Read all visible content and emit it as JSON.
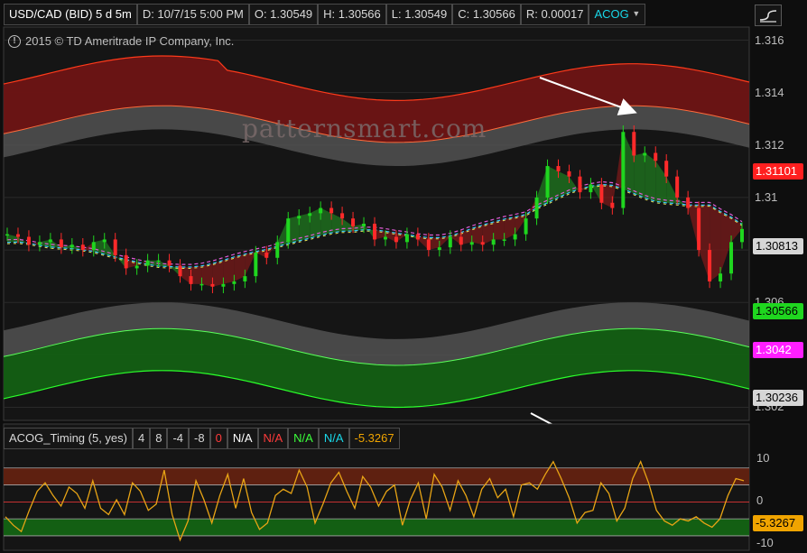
{
  "header": {
    "symbol": "USD/CAD (BID) 5 d 5m",
    "date": "D: 10/7/15 5:00 PM",
    "open": "O: 1.30549",
    "high": "H: 1.30566",
    "low": "L: 1.30549",
    "close": "C: 1.30566",
    "range": "R: 0.00017",
    "study": "ACOG",
    "study_menu_icon": "dropdown-arrow-icon",
    "tool_icon": "curve-tool-icon"
  },
  "copyright": "2015 © TD Ameritrade IP Company, Inc.",
  "watermark": "patternsmart.com",
  "price_axis": {
    "ticks": [
      "1.316",
      "1.314",
      "1.312",
      "1.31",
      "1.308",
      "1.306",
      "1.304",
      "1.302"
    ],
    "badges": [
      {
        "text": "1.31101",
        "bg": "#ff1f1f",
        "fg": "#ffffff",
        "value": 1.31101
      },
      {
        "text": "1.30813",
        "bg": "#d6d6d6",
        "fg": "#000000",
        "value": 1.30813
      },
      {
        "text": "1.30566",
        "bg": "#1fd61f",
        "fg": "#000000",
        "value": 1.30566
      },
      {
        "text": "1.3042",
        "bg": "#ff1fff",
        "fg": "#ffffff",
        "value": 1.3042
      },
      {
        "text": "1.30236",
        "bg": "#d6d6d6",
        "fg": "#000000",
        "value": 1.30236
      }
    ]
  },
  "indicator": {
    "name": "ACOG_Timing (5, yes)",
    "params": [
      "4",
      "8",
      "-4",
      "-8"
    ],
    "value_0": "0",
    "na_white": "N/A",
    "na_red": "N/A",
    "na_green": "N/A",
    "na_cyan": "N/A",
    "current": "-5.3267",
    "axis_ticks": [
      "10",
      "0",
      "-10"
    ],
    "current_badge_bg": "#f0a400"
  },
  "colors": {
    "background": "#0e0e0e",
    "up_candle": "#1fd61f",
    "down_candle": "#ff2a2a",
    "band_red": "#6e1414",
    "band_green": "#135f13",
    "band_gray": "#555555",
    "oscillator": "#e8a415"
  },
  "chart_data": [
    {
      "type": "candlestick",
      "title": "USD/CAD (BID) 5 d 5m",
      "ylim": [
        1.3015,
        1.3165
      ],
      "y_ticks": [
        1.316,
        1.314,
        1.312,
        1.31,
        1.308,
        1.306,
        1.304,
        1.302
      ],
      "grid": true,
      "series": [
        {
          "name": "close",
          "values": [
            1.3086,
            1.3085,
            1.3082,
            1.3083,
            1.3084,
            1.3081,
            1.3082,
            1.308,
            1.3083,
            1.3084,
            1.3078,
            1.3073,
            1.3074,
            1.3076,
            1.3076,
            1.3074,
            1.307,
            1.3067,
            1.3067,
            1.3066,
            1.3067,
            1.3068,
            1.307,
            1.3079,
            1.3077,
            1.3083,
            1.3092,
            1.3093,
            1.3094,
            1.3096,
            1.3094,
            1.3092,
            1.3089,
            1.309,
            1.3084,
            1.3085,
            1.3083,
            1.3086,
            1.3084,
            1.308,
            1.3081,
            1.3085,
            1.3082,
            1.3083,
            1.3082,
            1.3084,
            1.3084,
            1.3086,
            1.3092,
            1.31,
            1.3112,
            1.311,
            1.3108,
            1.3102,
            1.3105,
            1.3098,
            1.3096,
            1.3125,
            1.3116,
            1.3117,
            1.3114,
            1.3108,
            1.31,
            1.3096,
            1.308,
            1.3068,
            1.3071,
            1.3083,
            1.3088
          ]
        }
      ]
    },
    {
      "type": "line",
      "title": "ACOG_Timing (5, yes)",
      "ylim": [
        -11,
        12
      ],
      "y_ticks": [
        10,
        0,
        -10
      ],
      "series": [
        {
          "name": "ACOG_Timing",
          "values": [
            -3.5,
            -5.5,
            -7.0,
            -2.0,
            2.5,
            4.5,
            1.5,
            -1.0,
            3.5,
            2.0,
            -1.5,
            5.0,
            -1.5,
            -3.0,
            0.5,
            -3.0,
            4.5,
            2.5,
            -2.0,
            -0.5,
            7.5,
            -3.0,
            -9.0,
            -4.5,
            5.0,
            0.5,
            -5.0,
            1.5,
            6.5,
            -1.5,
            5.5,
            -2.5,
            -6.5,
            -5.0,
            1.5,
            3.0,
            2.0,
            7.5,
            3.5,
            -5.0,
            -0.5,
            4.5,
            7.0,
            2.5,
            -1.5,
            6.0,
            3.5,
            -1.0,
            2.5,
            4.0,
            -5.5,
            0.5,
            4.5,
            -4.0,
            6.5,
            3.5,
            -2.0,
            5.0,
            1.5,
            -3.5,
            3.0,
            5.5,
            1.0,
            3.0,
            -3.5,
            4.0,
            4.5,
            3.0,
            6.5,
            9.5,
            5.5,
            1.0,
            -5.0,
            -2.5,
            -2.0,
            4.5,
            2.0,
            -4.5,
            -1.5,
            5.5,
            9.5,
            4.5,
            -2.0,
            -4.5,
            -5.5,
            -4.0,
            -4.5,
            -3.5,
            -5.0,
            -6.0,
            -4.0,
            1.5,
            5.5,
            5.0
          ]
        }
      ]
    }
  ]
}
